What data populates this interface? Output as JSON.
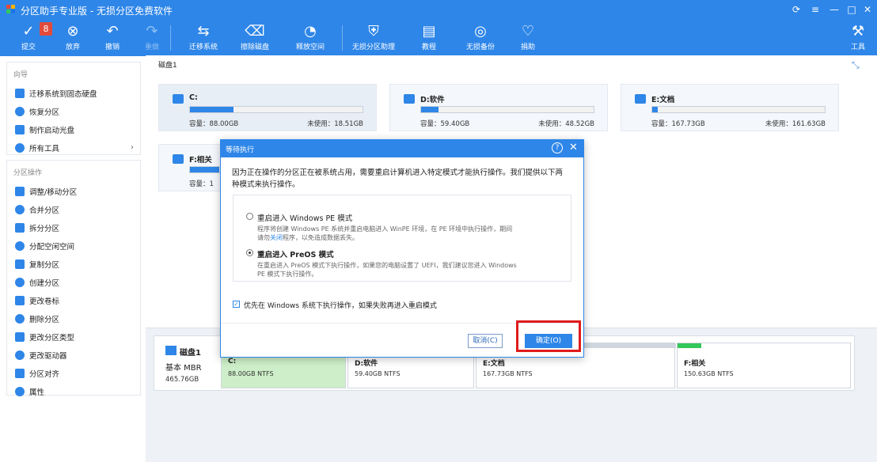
{
  "app": {
    "title": "分区助手专业版 - 无损分区免费软件",
    "colors": {
      "brand": "#2e86e8",
      "danger": "#e01b1b",
      "green": "#34c759"
    }
  },
  "window_controls": [
    {
      "name": "refresh-icon",
      "glyph": "⟳"
    },
    {
      "name": "menu-icon",
      "glyph": "≡"
    },
    {
      "name": "minimize-icon",
      "glyph": "—"
    },
    {
      "name": "maximize-icon",
      "glyph": "□"
    },
    {
      "name": "close-icon",
      "glyph": "✕"
    }
  ],
  "toolbar": {
    "badge": "8",
    "items": [
      {
        "label": "提交",
        "icon": "check-icon",
        "glyph": "✓",
        "disabled": false
      },
      {
        "label": "放弃",
        "icon": "cancel-icon",
        "glyph": "⊗",
        "disabled": false
      },
      {
        "label": "撤销",
        "icon": "undo-icon",
        "glyph": "↶",
        "disabled": false
      },
      {
        "label": "重做",
        "icon": "redo-icon",
        "glyph": "↷",
        "disabled": true
      },
      {
        "label": "迁移系统",
        "icon": "migrate-icon",
        "glyph": "⇆",
        "disabled": false
      },
      {
        "label": "擦除磁盘",
        "icon": "wipe-disk-icon",
        "glyph": "⌫",
        "disabled": false
      },
      {
        "label": "释放空间",
        "icon": "free-space-icon",
        "glyph": "◔",
        "disabled": false
      },
      {
        "label": "无损分区助理",
        "icon": "shield-icon",
        "glyph": "⛨",
        "disabled": false
      },
      {
        "label": "教程",
        "icon": "book-icon",
        "glyph": "▤",
        "disabled": false
      },
      {
        "label": "无损备份",
        "icon": "backup-icon",
        "glyph": "◎",
        "disabled": false
      },
      {
        "label": "捐助",
        "icon": "heart-icon",
        "glyph": "♡",
        "disabled": false
      }
    ],
    "tools_label": "工具"
  },
  "sidebar": {
    "wizard_head": "向导",
    "wizard_items": [
      {
        "label": "迁移系统到固态硬盘",
        "icon": "migrate-ssd-icon",
        "color": "#2e86e8"
      },
      {
        "label": "恢复分区",
        "icon": "restore-partition-icon",
        "color": "#2e86e8"
      },
      {
        "label": "制作启动光盘",
        "icon": "boot-disc-icon",
        "color": "#2e86e8"
      },
      {
        "label": "所有工具",
        "icon": "all-tools-icon",
        "color": "#2e86e8"
      }
    ],
    "ops_head": "分区操作",
    "ops_items": [
      {
        "label": "调整/移动分区",
        "icon": "resize-icon",
        "color": "#2e86e8"
      },
      {
        "label": "合并分区",
        "icon": "merge-icon",
        "color": "#2e86e8"
      },
      {
        "label": "拆分分区",
        "icon": "split-icon",
        "color": "#2e86e8"
      },
      {
        "label": "分配空闲空间",
        "icon": "allocate-icon",
        "color": "#2e86e8"
      },
      {
        "label": "复制分区",
        "icon": "copy-icon",
        "color": "#2e86e8"
      },
      {
        "label": "创建分区",
        "icon": "create-icon",
        "color": "#2e86e8"
      },
      {
        "label": "更改卷标",
        "icon": "label-icon",
        "color": "#2e86e8"
      },
      {
        "label": "删除分区",
        "icon": "delete-icon",
        "color": "#2e86e8"
      },
      {
        "label": "更改分区类型",
        "icon": "change-type-icon",
        "color": "#2e86e8"
      },
      {
        "label": "更改驱动器",
        "icon": "drive-letter-icon",
        "color": "#2e86e8"
      },
      {
        "label": "分区对齐",
        "icon": "align-icon",
        "color": "#2e86e8"
      },
      {
        "label": "属性",
        "icon": "info-icon",
        "color": "#2e86e8"
      }
    ]
  },
  "main": {
    "disk_title": "磁盘1",
    "partitions": [
      {
        "name": "C:",
        "capacity": "容量：88.00GB",
        "free": "未使用：18.51GB",
        "fill": 0.25,
        "selected": true
      },
      {
        "name": "D:软件",
        "capacity": "容量：59.40GB",
        "free": "未使用：48.52GB",
        "fill": 0.1,
        "selected": false
      },
      {
        "name": "E:文档",
        "capacity": "容量：167.73GB",
        "free": "未使用：161.63GB",
        "fill": 0.03,
        "selected": false
      },
      {
        "name": "F:相关",
        "capacity": "容量：1",
        "free": "",
        "fill": 0.17,
        "selected": false
      }
    ]
  },
  "diskmap": {
    "name": "磁盘1",
    "type": "基本 MBR",
    "size": "465.76GB",
    "segments": [
      {
        "name": "C:",
        "size": "88.00GB NTFS",
        "bar": "#2e86e8",
        "bg": "#cdeec8",
        "w": 160
      },
      {
        "name": "D:软件",
        "size": "59.40GB NTFS",
        "bar": "#cfd6df",
        "bg": "#ffffff",
        "w": 162
      },
      {
        "name": "E:文档",
        "size": "167.73GB NTFS",
        "bar": "#cfd6df",
        "bg": "#ffffff",
        "w": 254
      },
      {
        "name": "F:相关",
        "size": "150.63GB NTFS",
        "bar": "#34c759",
        "bg": "#ffffff",
        "w": 222
      }
    ]
  },
  "dialog": {
    "title": "等待执行",
    "message": "因为正在操作的分区正在被系统占用，需要重启计算机进入特定模式才能执行操作。我们提供以下两种模式来执行操作。",
    "opt1_title": "重启进入 Windows PE 模式",
    "opt1_desc": "程序将创建 Windows PE 系统并重启电脑进入 WinPE 环境，在 PE 环境中执行操作，期间请勿",
    "opt1_link": "关闭",
    "opt1_desc2": "程序，以免造成数据丢失。",
    "opt2_title": "重启进入 PreOS 模式",
    "opt2_desc": "在重启进入 PreOS 模式下执行操作，如果您的电脑设置了 UEFI，我们建议您进入 Windows PE 模式下执行操作。",
    "checkbox_label": "优先在 Windows 系统下执行操作，如果失败再进入重启模式",
    "cancel_label": "取消(C)",
    "ok_label": "确定(O)"
  }
}
